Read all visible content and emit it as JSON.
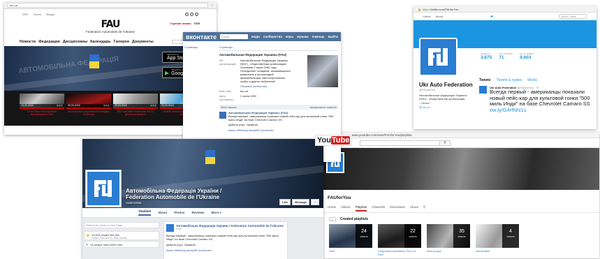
{
  "fau_site": {
    "address_bar": "fau.ua",
    "top_links": [
      "ОФУ",
      "Почта",
      "Форум"
    ],
    "hotline_label": "Горячая линия:",
    "hotline_value": "7055",
    "logo_text": "FAU",
    "subtitle": "Federation Automobile de l'Ukraine",
    "nav": [
      "Новости",
      "Федерация",
      "Дисциплины",
      "Календарь",
      "Галерея",
      "Документы"
    ],
    "search_icon": "search-icon",
    "hero_watermark": "АВТОМОБІЛЬНА ФЕДЕРАЦІЯ",
    "store_buttons": [
      {
        "small": "Загрузите в",
        "name": "App Store",
        "icon": ""
      },
      {
        "small": "Загрузите на",
        "name": "Google play",
        "icon": "▶"
      }
    ],
    "news": [
      {
        "date": "15.04.2016",
        "caption": "О поставке многоцелевой автомобилей в ОФУ"
      },
      {
        "date": "08.04.2016",
        "caption": "Анонсирован спортивный календарь 2016 года"
      },
      {
        "date": "29.03.2016",
        "caption": "ФАУ возглавит Комиссию FIA по делам автоспорта"
      },
      {
        "date": "22.03.2016",
        "caption": "Новые назначения в руководстве ФАУ"
      }
    ]
  },
  "vk": {
    "logo": "вконтакте",
    "search_placeholder": "Поиск",
    "menu": [
      "люди",
      "сообщества",
      "игры",
      "музыка",
      "помощь",
      "выйти"
    ],
    "left_menu": [
      "Страницы"
    ],
    "join_label": "Вступить",
    "join_count": "12+",
    "breadcrumb": "Страницы",
    "title": "Автомобильная Федерация Украины (FAU)",
    "info": [
      {
        "key": "Об организации:",
        "value": "Автомобильная Федерация Украины (ФАУ) - общественная организация. Основана 2 июля 1992 года. Объединяет гонщиков, занимающихся развитием и пропагандой автомобилизма, автоспортсменов, клубы и других любителей."
      },
      {
        "key": "Веб-сайт:",
        "value": "fau.ua"
      },
      {
        "key": "Дата основания:",
        "value": "2 июля 1992"
      }
    ],
    "more_link": "Показать полностью...",
    "wall_label": "3644 записи",
    "wall_right": "предложить новость",
    "post": {
      "author": "Автомобильная Федерация Украины (FAU)",
      "text": "Всегда первый - американцы показали новый пейс-кар для культовой гонки \"500 миль Инди\" на базе Chevrolet Camaro SS.",
      "greeting": "Доброе утро, Украина!",
      "tags": "#авто #500indy #indy500 #chevrolet"
    }
  },
  "twitter": {
    "url_host": "https://",
    "url_rest": "twitter.com/FAUforYou",
    "nav": [
      "Home",
      "About"
    ],
    "search_placeholder": "Search Twitter",
    "stats": [
      {
        "label": "TWEETS",
        "value": "3,875"
      },
      {
        "label": "FOLLOWING",
        "value": "71"
      },
      {
        "label": "FOLLOWERS",
        "value": "9,603"
      }
    ],
    "name": "Ukr Auto Federation",
    "handle": "@FAUforYou",
    "bio": "Автомобильная федерация Украины (FAU) - общественная организация.",
    "location": "Ukraine",
    "website": "fau.ua",
    "tabs": [
      "Tweets",
      "Tweets & replies",
      "Media"
    ],
    "tweet": {
      "author": "Ukr Auto Federation",
      "meta": "@FAUforYou · 7h",
      "text": "Всегда первый - американцы показали новый пейс-кар для культовой гонки \"500 миль Инди\" на базе Chevrolet Camaro SS",
      "link": "ow.ly/G4rfNN1u"
    }
  },
  "youtube": {
    "address": "www.youtube.com/user/FAUforYou/playlists",
    "logo_you": "You",
    "logo_tube": "Tube",
    "channel_name": "FAUforYou",
    "tabs": [
      "Home",
      "Videos",
      "Playlists",
      "Channels",
      "Discussion",
      "About"
    ],
    "section_title": "Created playlists",
    "back_label": "‹›",
    "video_label": "VIDEOS",
    "playlists": [
      {
        "count": "24",
        "title": "Ралі"
      },
      {
        "count": "22",
        "title": "Соціальна активність FAU та FAU"
      },
      {
        "count": "35",
        "title": "Кантрі-крос"
      },
      {
        "count": "4",
        "title": "Автомобілі"
      }
    ]
  },
  "facebook": {
    "name_line1": "Автомобільна Федерація України /",
    "name_line2": "Federation Automobile de l'Ukraine",
    "category": "Automotive",
    "buttons": [
      "Like",
      "Message",
      "···"
    ],
    "tabs": [
      "Timeline",
      "About",
      "Photos",
      "Reviews",
      "More ▾"
    ],
    "search_placeholder": "Search for posts on this Page",
    "likes_text": "10,844 people like this",
    "likes_sub": "Dmytro Kan and 11 other friends",
    "visits_text": "13 people have been here",
    "post": {
      "author": "Автомобільна Федерація України / Federation Automobile de l'Ukraine",
      "date": "6 hrs ·",
      "text": "Всегда первый - американцы показали новый пейс-кар для культовой гонки \"500 миль Инди\" на базе Chevrolet Camaro SS.",
      "greeting": "Доброе утро, Украина!",
      "tags": "#авто #500indy #indy500 #chevrolet"
    }
  }
}
